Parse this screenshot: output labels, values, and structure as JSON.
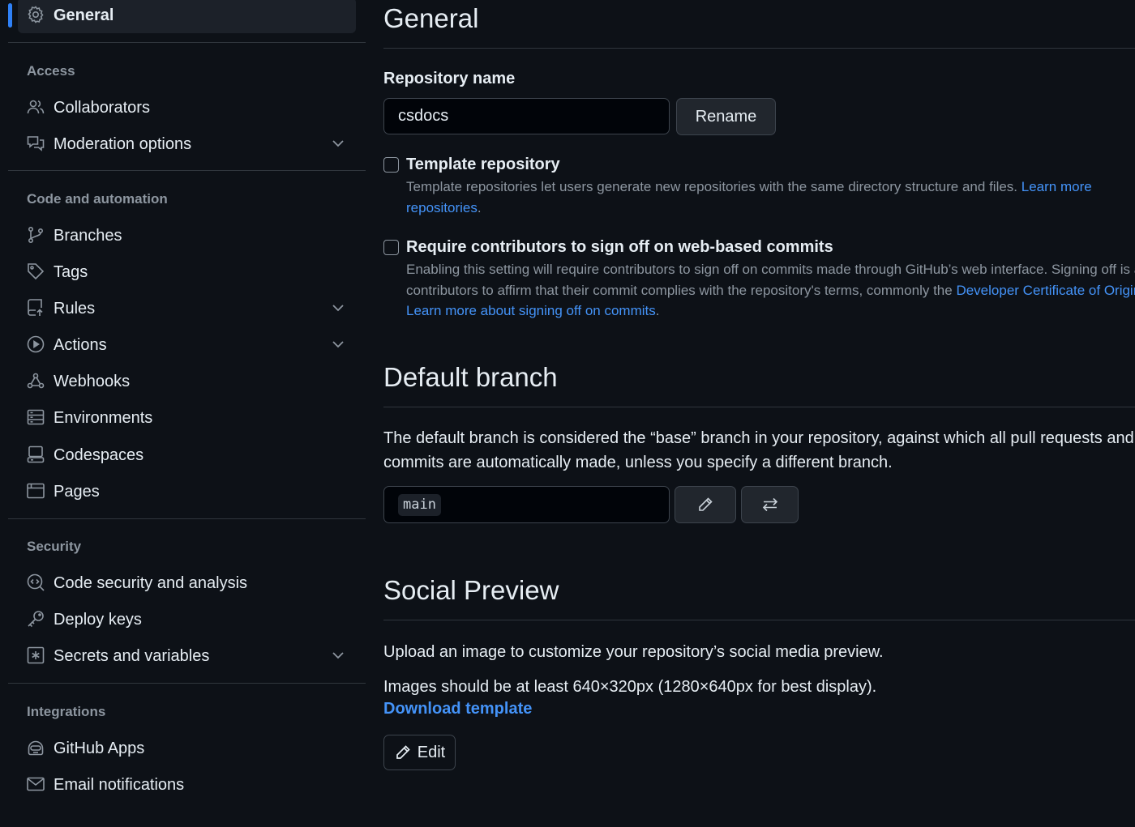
{
  "sidebar": {
    "general": {
      "label": "General",
      "icon": "gear-icon"
    },
    "groups": {
      "access": "Access",
      "code_automation": "Code and automation",
      "security": "Security",
      "integrations": "Integrations"
    },
    "items": {
      "collaborators": {
        "label": "Collaborators",
        "icon": "people-icon"
      },
      "moderation": {
        "label": "Moderation options",
        "icon": "comment-discussion-icon"
      },
      "branches": {
        "label": "Branches",
        "icon": "git-branch-icon"
      },
      "tags": {
        "label": "Tags",
        "icon": "tag-icon"
      },
      "rules": {
        "label": "Rules",
        "icon": "repo-push-icon"
      },
      "actions": {
        "label": "Actions",
        "icon": "play-icon"
      },
      "webhooks": {
        "label": "Webhooks",
        "icon": "webhook-icon"
      },
      "environments": {
        "label": "Environments",
        "icon": "server-icon"
      },
      "codespaces": {
        "label": "Codespaces",
        "icon": "codespaces-icon"
      },
      "pages": {
        "label": "Pages",
        "icon": "browser-icon"
      },
      "code_security": {
        "label": "Code security and analysis",
        "icon": "codescan-icon"
      },
      "deploy_keys": {
        "label": "Deploy keys",
        "icon": "key-icon"
      },
      "secrets": {
        "label": "Secrets and variables",
        "icon": "key-asterisk-icon"
      },
      "github_apps": {
        "label": "GitHub Apps",
        "icon": "hubot-icon"
      },
      "email": {
        "label": "Email notifications",
        "icon": "mail-icon"
      }
    }
  },
  "main": {
    "general_heading": "General",
    "repo_name_label": "Repository name",
    "repo_name_value": "csdocs",
    "rename_button": "Rename",
    "template": {
      "title": "Template repository",
      "desc_text": "Template repositories let users generate new repositories with the same directory structure and files. ",
      "desc_link": "Learn more about template repositories",
      "desc_link_l1": "Learn more",
      "desc_link_l2": "repositories",
      "desc_end": ".",
      "checked": false
    },
    "signoff": {
      "title": "Require contributors to sign off on web-based commits",
      "line1": "Enabling this setting will require contributors to sign off on commits made through GitHub’s web interface. Signing off is a way for",
      "line2_text": "contributors to affirm that their commit complies with the repository's terms, commonly the ",
      "line2_link": "Developer Certificate of Origin",
      "line3_link": "Learn more about signing off on commits",
      "line3_end": ".",
      "checked": false
    },
    "default_branch": {
      "heading": "Default branch",
      "desc1": "The default branch is considered the “base” branch in your repository, against which all pull requests and code",
      "desc2": "commits are automatically made, unless you specify a different branch.",
      "branch": "main",
      "edit_icon": "pencil-icon",
      "switch_icon": "arrow-switch-icon"
    },
    "social_preview": {
      "heading": "Social Preview",
      "desc1": "Upload an image to customize your repository’s social media preview.",
      "desc2": "Images should be at least 640×320px (1280×640px for best display).",
      "download_link": "Download template",
      "edit_button": "Edit"
    }
  },
  "colors": {
    "background": "#0d1117",
    "border": "#30363d",
    "text": "#e6edf3",
    "muted": "#8d96a0",
    "link": "#4493f8",
    "accent": "#2f81f7"
  }
}
